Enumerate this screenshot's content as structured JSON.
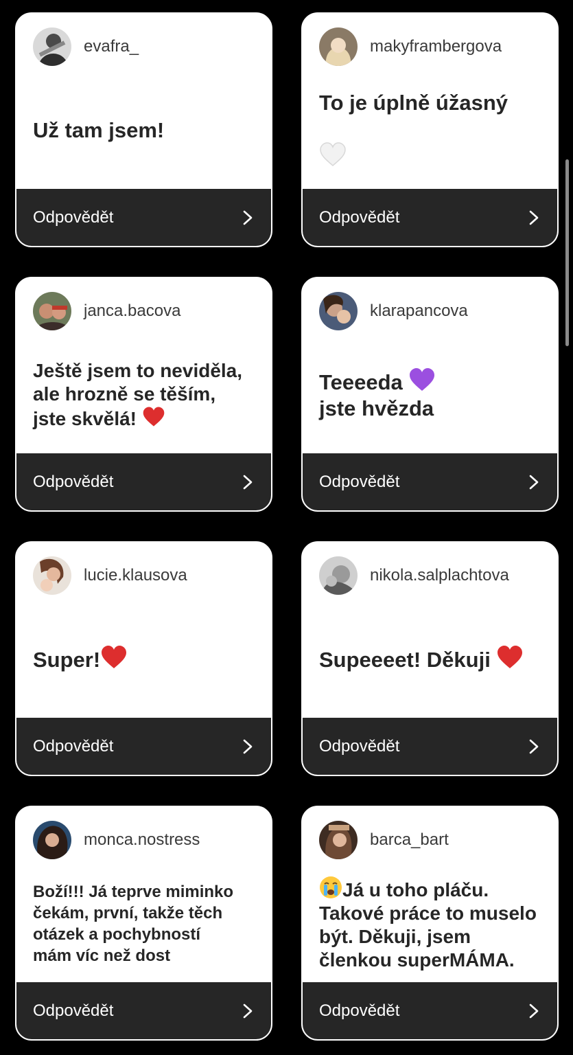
{
  "reply_label": "Odpovědět",
  "colors": {
    "background": "#000000",
    "card": "#ffffff",
    "reply_bar": "#262626"
  },
  "cards": [
    {
      "username": "evafra_",
      "message": "Už tam jsem!",
      "avatar": "profile-photo"
    },
    {
      "username": "makyframbergova",
      "message": "To je úplně úžasný",
      "emoji": "white-heart-icon",
      "avatar": "profile-photo"
    },
    {
      "username": "janca.bacova",
      "message": "Ještě jsem to neviděla,\nale hrozně se těším,\njste skvělá!",
      "emoji": "red-heart-icon",
      "avatar": "profile-photo"
    },
    {
      "username": "klarapancova",
      "message": "Teeeeda",
      "message_line2": "jste hvězda",
      "emoji": "purple-heart-icon",
      "avatar": "profile-photo"
    },
    {
      "username": "lucie.klausova",
      "message": "Super!",
      "emoji": "red-heart-icon",
      "avatar": "profile-photo"
    },
    {
      "username": "nikola.salplachtova",
      "message": "Supeeeet! Děkuji",
      "emoji": "red-heart-icon",
      "avatar": "profile-photo"
    },
    {
      "username": "monca.nostress",
      "message": "Boží!!! Já teprve miminko\nčekám,  první, takže těch\notázek a pochybností\nmám víc než dost",
      "avatar": "profile-photo"
    },
    {
      "username": "barca_bart",
      "message": "Já u toho pláču.\nTakové práce to muselo\nbýt. Děkuji, jsem\nčlenkou superMÁMA.",
      "emoji": "crying-face-icon",
      "avatar": "profile-photo"
    }
  ]
}
